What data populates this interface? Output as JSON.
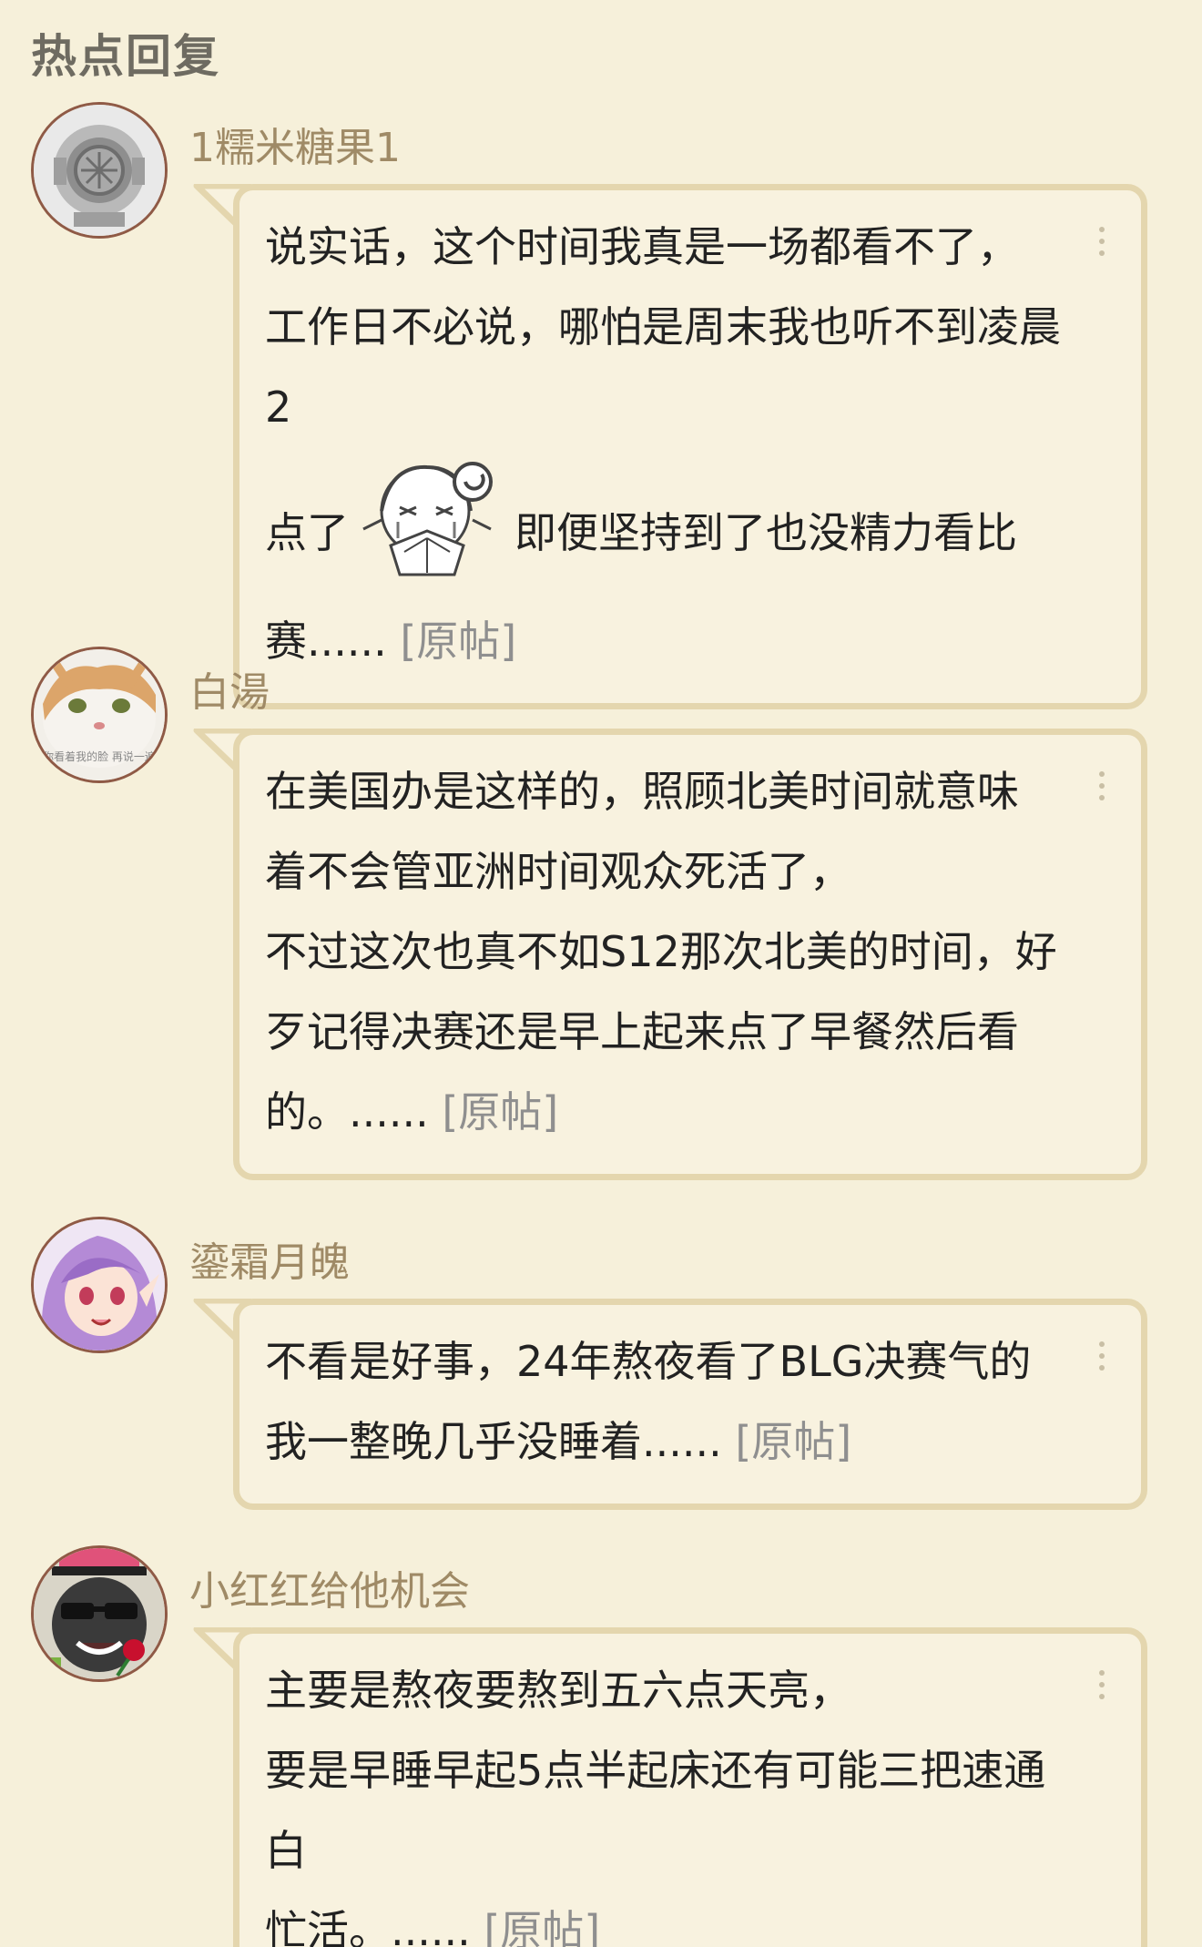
{
  "section_title": "热点回复",
  "replies": [
    {
      "username": "1糯米糖果1",
      "lines": [
        "说实话，这个时间我真是一场都看不了，",
        "工作日不必说，哪怕是周末我也听不到凌晨2",
        "点了",
        "即便坚持到了也没精力看比",
        "赛......"
      ],
      "original_link": "[原帖]"
    },
    {
      "username": "白湯",
      "avatar_caption": "你看着我的脸 再说一遍",
      "lines": [
        "在美国办是这样的，照顾北美时间就意味",
        "着不会管亚洲时间观众死活了，",
        "不过这次也真不如S12那次北美的时间，好",
        "歹记得决赛还是早上起来点了早餐然后看",
        "的。......"
      ],
      "original_link": "[原帖]"
    },
    {
      "username": "鎏霜月魄",
      "lines": [
        "不看是好事，24年熬夜看了BLG决赛气的",
        "我一整晚几乎没睡着......"
      ],
      "original_link": "[原帖]"
    },
    {
      "username": "小红红给他机会",
      "lines": [
        "主要是熬夜要熬到五六点天亮，",
        "要是早睡早起5点半起床还有可能三把速通白",
        "忙活。......"
      ],
      "original_link": "[原帖]"
    }
  ],
  "colors": {
    "background": "#f6f0da",
    "bubble_border": "#e4d6ae",
    "username": "#9f8a66",
    "original_link": "#8f8f8f"
  }
}
